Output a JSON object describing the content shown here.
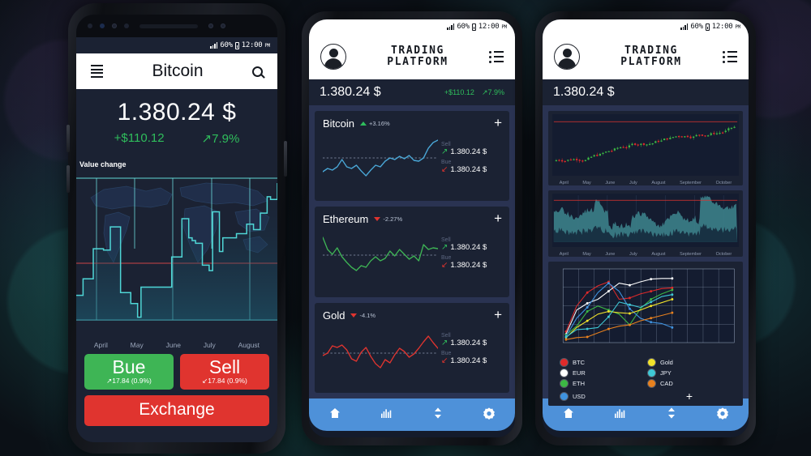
{
  "statusbar": {
    "battery": "60%",
    "time": "12:00",
    "ampm": "PM"
  },
  "phone1": {
    "appbar": {
      "title": "Bitcoin",
      "menu_icon": "hamburger-icon",
      "search_icon": "search-icon"
    },
    "price": {
      "value": "1.380.24 $",
      "change_abs": "+$110.12",
      "change_pct": "7.9%",
      "change_arrow": "↗"
    },
    "chart": {
      "label": "Value change",
      "months": [
        "April",
        "May",
        "June",
        "July",
        "August"
      ]
    },
    "buttons": {
      "buy": {
        "label": "Bue",
        "meta": "17.84 (0.9%)",
        "arrow": "↗",
        "color": "#3eb555"
      },
      "sell": {
        "label": "Sell",
        "meta": "17.84 (0.9%)",
        "arrow": "↙",
        "color": "#e0342f"
      },
      "exchange": {
        "label": "Exchange",
        "color": "#e0342f"
      }
    }
  },
  "phone2": {
    "appbar": {
      "brand_line1": "TRADING",
      "brand_line2": "PLATFORM",
      "avatar_icon": "avatar-icon",
      "menu_icon": "list-icon"
    },
    "pricebar": {
      "value": "1.380.24 $",
      "change_abs": "+$110.12",
      "change_pct": "7.9%",
      "change_arrow": "↗"
    },
    "cards": [
      {
        "name": "Bitcoin",
        "pct": "+3.16%",
        "direction": "up",
        "color": "#4aa8d8",
        "sell_label": "Sell",
        "sell_value": "1.380.24 $",
        "buy_label": "Bue",
        "buy_value": "1.380.24 $",
        "add_icon": "plus-icon"
      },
      {
        "name": "Ethereum",
        "pct": "-2.27%",
        "direction": "down",
        "color": "#3eb555",
        "sell_label": "Sell",
        "sell_value": "1.380.24 $",
        "buy_label": "Bue",
        "buy_value": "1.380.24 $",
        "add_icon": "plus-icon"
      },
      {
        "name": "Gold",
        "pct": "-4.1%",
        "direction": "down",
        "color": "#e0342f",
        "sell_label": "Sell",
        "sell_value": "1.380.24 $",
        "buy_label": "Bue",
        "buy_value": "1.380.24 $",
        "add_icon": "plus-icon"
      }
    ],
    "nav": [
      {
        "icon": "home-icon",
        "name": "nav-home"
      },
      {
        "icon": "bar-chart-icon",
        "name": "nav-charts"
      },
      {
        "icon": "exchange-arrows-icon",
        "name": "nav-exchange"
      },
      {
        "icon": "gear-icon",
        "name": "nav-settings"
      }
    ]
  },
  "phone3": {
    "appbar": {
      "brand_line1": "TRADING",
      "brand_line2": "PLATFORM",
      "avatar_icon": "avatar-icon",
      "menu_icon": "list-icon"
    },
    "pricebar": {
      "value": "1.380.24 $"
    },
    "months": [
      "April",
      "May",
      "June",
      "July",
      "August",
      "September",
      "October"
    ],
    "legend": [
      {
        "label": "BTC",
        "color": "#e02a2a"
      },
      {
        "label": "Gold",
        "color": "#f2e32a"
      },
      {
        "label": "EUR",
        "color": "#ffffff"
      },
      {
        "label": "JPY",
        "color": "#3ec9d6"
      },
      {
        "label": "ETH",
        "color": "#3cb944"
      },
      {
        "label": "CAD",
        "color": "#e8811e"
      },
      {
        "label": "USD",
        "color": "#3f93e0"
      }
    ],
    "legend_add_icon": "plus-icon",
    "nav": [
      {
        "icon": "home-icon",
        "name": "nav-home"
      },
      {
        "icon": "bar-chart-icon",
        "name": "nav-charts"
      },
      {
        "icon": "exchange-arrows-icon",
        "name": "nav-exchange"
      },
      {
        "icon": "gear-icon",
        "name": "nav-settings"
      }
    ]
  },
  "chart_data": [
    {
      "id": "phone1-value-change",
      "type": "area",
      "title": "Value change",
      "xlabel": "",
      "ylabel": "",
      "tick_labels": [
        "April",
        "May",
        "June",
        "July",
        "August"
      ],
      "line_color": "#4fd6d6",
      "threshold_line_color": "#e0342f",
      "grid": true,
      "x": [
        0,
        2,
        4,
        6,
        8,
        10,
        12,
        14,
        16,
        18,
        20,
        22,
        24,
        26,
        28,
        30,
        32,
        34,
        36,
        38,
        40,
        42,
        44,
        46,
        48,
        50,
        52,
        54,
        56,
        58,
        60,
        62,
        64,
        66,
        68,
        70,
        72,
        74,
        76,
        78,
        80,
        82,
        84,
        86,
        88,
        90,
        92,
        94,
        96,
        98,
        100
      ],
      "values": [
        18,
        18,
        30,
        30,
        30,
        52,
        52,
        52,
        51,
        51,
        68,
        68,
        68,
        20,
        20,
        20,
        12,
        12,
        2,
        24,
        24,
        24,
        24,
        24,
        24,
        24,
        24,
        24,
        46,
        46,
        46,
        74,
        74,
        60,
        58,
        56,
        56,
        40,
        40,
        36,
        79,
        79,
        50,
        60,
        60,
        60,
        60,
        63,
        63,
        63,
        70,
        70,
        66,
        66,
        78,
        78,
        90,
        88,
        88,
        100
      ]
    },
    {
      "id": "phone2-bitcoin-spark",
      "type": "line",
      "title": "Bitcoin",
      "series_color": "#4aa8d8",
      "baseline": 52,
      "values": [
        18,
        26,
        22,
        30,
        48,
        30,
        26,
        34,
        20,
        8,
        22,
        34,
        30,
        44,
        52,
        48,
        56,
        50,
        58,
        46,
        44,
        52,
        76,
        90,
        96
      ]
    },
    {
      "id": "phone2-ethereum-spark",
      "type": "line",
      "title": "Ethereum",
      "series_color": "#3eb555",
      "baseline": 48,
      "values": [
        92,
        62,
        50,
        66,
        44,
        30,
        18,
        10,
        22,
        18,
        34,
        44,
        34,
        40,
        58,
        46,
        62,
        50,
        38,
        46,
        34,
        74,
        62,
        66,
        64
      ]
    },
    {
      "id": "phone2-gold-spark",
      "type": "line",
      "title": "Gold",
      "series_color": "#e0342f",
      "baseline": 44,
      "values": [
        38,
        44,
        62,
        58,
        64,
        52,
        30,
        24,
        46,
        58,
        36,
        18,
        8,
        28,
        20,
        40,
        56,
        48,
        34,
        42,
        56,
        72,
        86,
        70,
        56
      ]
    },
    {
      "id": "phone3-candlestick",
      "type": "candlestick",
      "title": "",
      "tick_labels": [
        "April",
        "May",
        "June",
        "July",
        "August",
        "September",
        "October"
      ],
      "threshold_line_color": "#e0342f",
      "up_color": "#3cb944",
      "down_color": "#e02a2a"
    },
    {
      "id": "phone3-volume-area",
      "type": "area",
      "title": "",
      "tick_labels": [
        "April",
        "May",
        "June",
        "July",
        "August",
        "September",
        "October"
      ],
      "fill_color": "#3b7e88",
      "threshold_line_color": "#e0342f"
    },
    {
      "id": "phone3-multi-line",
      "type": "line",
      "title": "",
      "grid": true,
      "legend_position": "bottom",
      "x": [
        0,
        1,
        2,
        3,
        4,
        5,
        6,
        7,
        8,
        9,
        10
      ],
      "series": [
        {
          "name": "BTC",
          "color": "#e02a2a",
          "values": [
            14,
            52,
            72,
            82,
            88,
            62,
            64,
            70,
            74,
            78,
            79
          ]
        },
        {
          "name": "EUR",
          "color": "#ffffff",
          "values": [
            10,
            46,
            56,
            62,
            74,
            86,
            83,
            88,
            92,
            93,
            93
          ]
        },
        {
          "name": "ETH",
          "color": "#3cb944",
          "values": [
            9,
            22,
            44,
            52,
            46,
            40,
            24,
            48,
            62,
            70,
            76
          ]
        },
        {
          "name": "USD",
          "color": "#3f93e0",
          "values": [
            7,
            34,
            50,
            72,
            86,
            74,
            48,
            34,
            28,
            26,
            20
          ]
        },
        {
          "name": "Gold",
          "color": "#f2e32a",
          "values": [
            5,
            20,
            30,
            40,
            44,
            42,
            41,
            46,
            52,
            57,
            62
          ]
        },
        {
          "name": "JPY",
          "color": "#3ec9d6",
          "values": [
            6,
            17,
            18,
            20,
            36,
            58,
            54,
            50,
            58,
            66,
            69
          ]
        },
        {
          "name": "CAD",
          "color": "#e8811e",
          "values": [
            2,
            5,
            6,
            12,
            18,
            22,
            24,
            30,
            34,
            38,
            42
          ]
        }
      ]
    }
  ]
}
